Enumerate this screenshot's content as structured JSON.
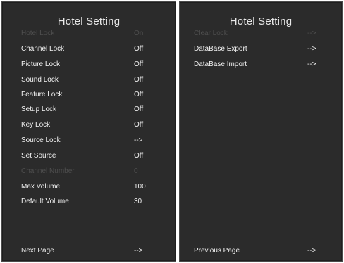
{
  "left_panel": {
    "title": "Hotel Setting",
    "items": [
      {
        "label": "Hotel Lock",
        "value": "On",
        "enabled": false
      },
      {
        "label": "Channel Lock",
        "value": "Off",
        "enabled": true
      },
      {
        "label": "Picture Lock",
        "value": "Off",
        "enabled": true
      },
      {
        "label": "Sound Lock",
        "value": "Off",
        "enabled": true
      },
      {
        "label": "Feature Lock",
        "value": "Off",
        "enabled": true
      },
      {
        "label": "Setup Lock",
        "value": "Off",
        "enabled": true
      },
      {
        "label": "Key Lock",
        "value": "Off",
        "enabled": true
      },
      {
        "label": "Source Lock",
        "value": "-->",
        "enabled": true
      },
      {
        "label": "Set Source",
        "value": "Off",
        "enabled": true
      },
      {
        "label": "Channel Number",
        "value": "0",
        "enabled": false
      },
      {
        "label": "Max Volume",
        "value": "100",
        "enabled": true
      },
      {
        "label": "Default Volume",
        "value": "30",
        "enabled": true
      }
    ],
    "next_page": {
      "label": "Next Page",
      "value": "-->"
    }
  },
  "right_panel": {
    "title": "Hotel Setting",
    "items": [
      {
        "label": "Clear Lock",
        "value": "-->",
        "enabled": false
      },
      {
        "label": "DataBase Export",
        "value": "-->",
        "enabled": true
      },
      {
        "label": "DataBase Import",
        "value": "-->",
        "enabled": true
      }
    ],
    "previous_page": {
      "label": "Previous Page",
      "value": "-->"
    }
  },
  "colors": {
    "panel_bg": "#2b2b2b",
    "text": "#f2f2f2",
    "disabled_text": "#4e4e4e",
    "page_bg": "#ffffff"
  }
}
